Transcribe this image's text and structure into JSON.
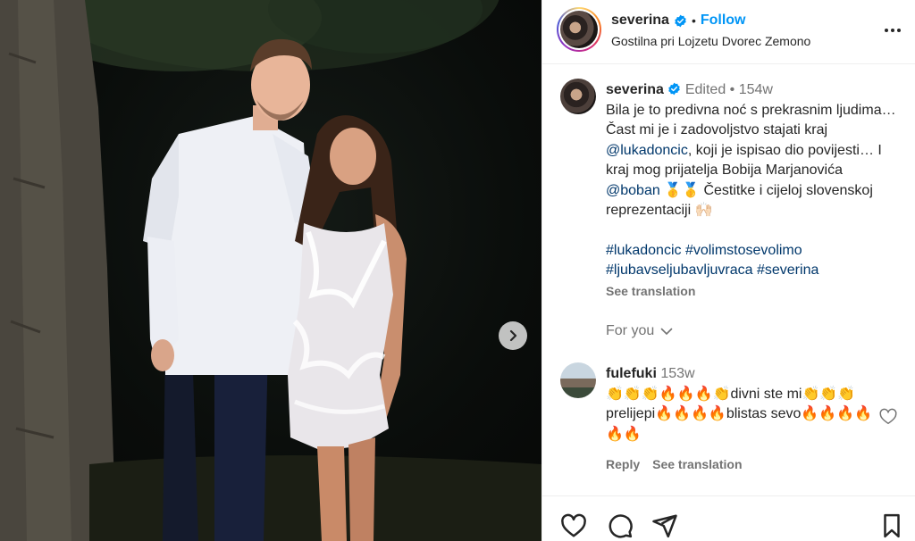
{
  "colors": {
    "accent": "#0095f6",
    "verified": "#0095f6",
    "muted": "#737373",
    "link": "#00376b"
  },
  "post": {
    "username": "severina",
    "follow_label": "Follow",
    "location": "Gostilna pri Lojzetu Dvorec Zemono",
    "more_icon": "more-horizontal-icon"
  },
  "caption": {
    "username": "severina",
    "edited": "Edited",
    "separator": "•",
    "age": "154w",
    "text_1": "Bila je to predivna noć s prekrasnim ljudima… Čast mi je i zadovoljstvo stajati kraj ",
    "mention_1": "@lukadoncic",
    "text_2": ", koji je ispisao dio povijesti… I kraj mog prijatelja Bobija Marjanovića ",
    "mention_2": "@boban",
    "text_3": " 🥇🥇 Čestitke i cijeloj slovenskoj reprezentaciji 🙌🏻",
    "hashtags_line_1": "#lukadoncic #volimstosevolimo",
    "hashtags_line_2": "#ljubavseljubavljuvraca #severina",
    "see_translation": "See translation"
  },
  "for_you": "For you",
  "comment": {
    "username": "fulefuki",
    "age": "153w",
    "text": "👏👏👏🔥🔥🔥👏divni ste mi👏👏👏prelijepi🔥🔥🔥🔥blistas sevo🔥🔥🔥🔥🔥🔥",
    "reply": "Reply",
    "see_translation": "See translation"
  }
}
